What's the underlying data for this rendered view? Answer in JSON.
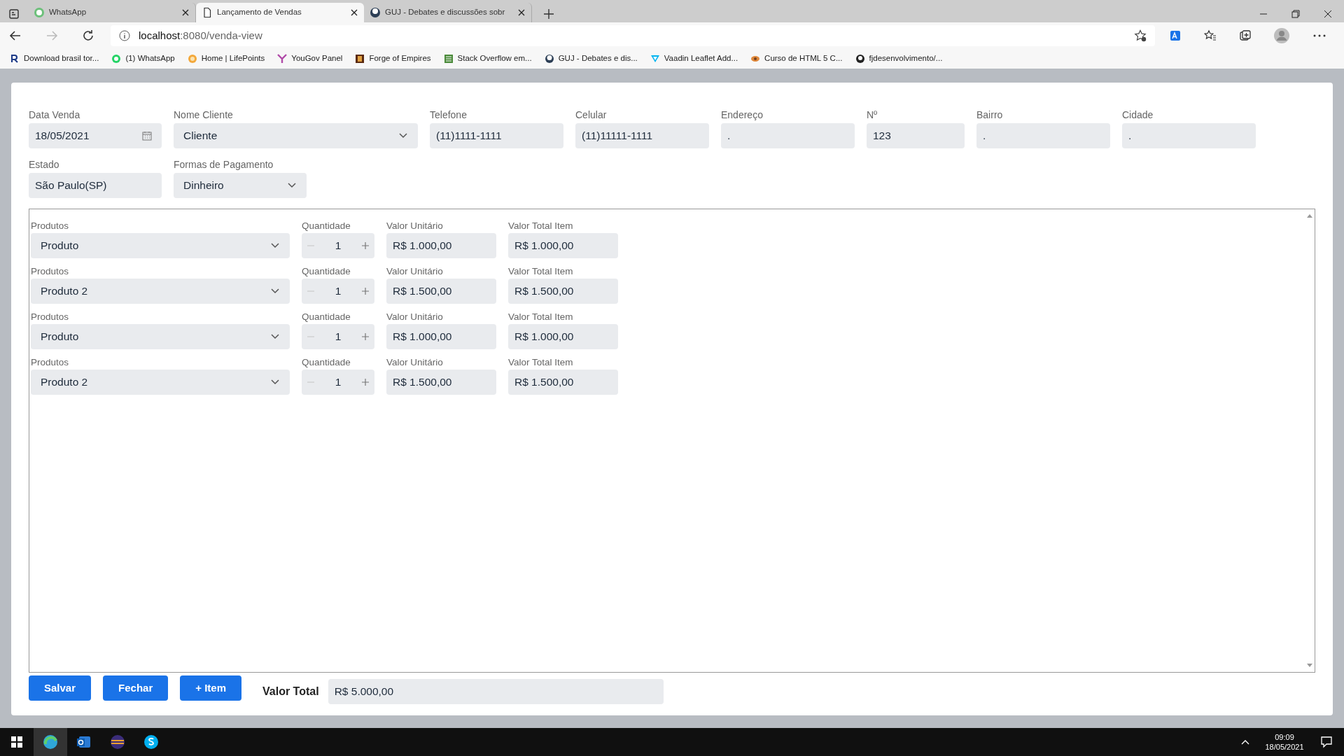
{
  "browser": {
    "tabs": [
      {
        "title": "WhatsApp",
        "selected": false
      },
      {
        "title": "Lançamento de Vendas",
        "selected": true
      },
      {
        "title": "GUJ - Debates e discussões sobr",
        "selected": false
      }
    ],
    "address": {
      "host": "localhost",
      "path": ":8080/venda-view"
    },
    "bookmarks": [
      "Download brasil tor...",
      "(1) WhatsApp",
      "Home | LifePoints",
      "YouGov Panel",
      "Forge of Empires",
      "Stack Overflow em...",
      "GUJ - Debates e dis...",
      "Vaadin Leaflet Add...",
      "Curso de HTML 5 C...",
      "fjdesenvolvimento/..."
    ]
  },
  "form": {
    "rows": [
      [
        {
          "label": "Data Venda",
          "value": "18/05/2021",
          "kind": "date"
        },
        {
          "label": "Nome Cliente",
          "value": "Cliente",
          "kind": "select"
        },
        {
          "label": "Telefone",
          "value": "(11)1111-1111",
          "kind": "text"
        },
        {
          "label": "Celular",
          "value": "(11)11111-1111",
          "kind": "text"
        },
        {
          "label": "Endereço",
          "value": ".",
          "kind": "text"
        },
        {
          "label": "Nº",
          "value": "123",
          "kind": "text"
        },
        {
          "label": "Bairro",
          "value": ".",
          "kind": "text"
        },
        {
          "label": "Cidade",
          "value": ".",
          "kind": "text"
        }
      ],
      [
        {
          "label": "Estado",
          "value": "São Paulo(SP)",
          "kind": "text"
        },
        {
          "label": "Formas de Pagamento",
          "value": "Dinheiro",
          "kind": "select"
        }
      ]
    ]
  },
  "items": [
    {
      "product_label": "Produtos",
      "product": "Produto",
      "quantity_label": "Quantidade",
      "quantity": "1",
      "decrement_disabled": true,
      "unit_label": "Valor Unitário",
      "unit_price": "R$ 1.000,00",
      "total_label": "Valor Total Item",
      "total": "R$ 1.000,00"
    },
    {
      "product_label": "Produtos",
      "product": "Produto 2",
      "quantity_label": "Quantidade",
      "quantity": "1",
      "decrement_disabled": true,
      "unit_label": "Valor Unitário",
      "unit_price": "R$ 1.500,00",
      "total_label": "Valor Total Item",
      "total": "R$ 1.500,00"
    },
    {
      "product_label": "Produtos",
      "product": "Produto",
      "quantity_label": "Quantidade",
      "quantity": "1",
      "decrement_disabled": true,
      "unit_label": "Valor Unitário",
      "unit_price": "R$ 1.000,00",
      "total_label": "Valor Total Item",
      "total": "R$ 1.000,00"
    },
    {
      "product_label": "Produtos",
      "product": "Produto 2",
      "quantity_label": "Quantidade",
      "quantity": "1",
      "decrement_disabled": true,
      "unit_label": "Valor Unitário",
      "unit_price": "R$ 1.500,00",
      "total_label": "Valor Total Item",
      "total": "R$ 1.500,00"
    }
  ],
  "buttons": [
    "Salvar",
    "Fechar",
    "+ Item"
  ],
  "total": {
    "label": "Valor Total",
    "value": "R$ 5.000,00"
  },
  "taskbar": {
    "time": "09:09",
    "date": "18/05/2021"
  }
}
